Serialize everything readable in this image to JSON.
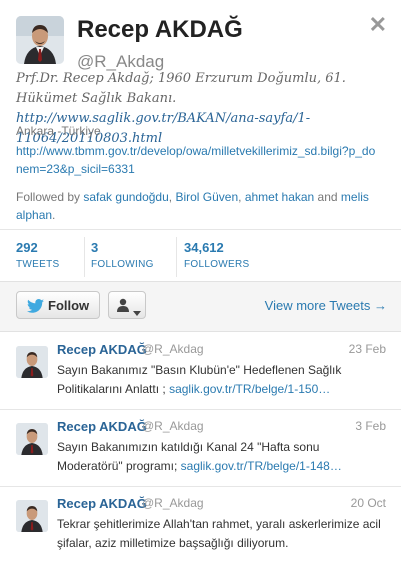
{
  "profile": {
    "name": "Recep AKDAĞ",
    "handle": "@R_Akdag",
    "bio_text": "Prf.Dr. Recep Akdağ; 1960 Erzurum Doğumlu, 61. Hükümet Sağlık Bakanı. ",
    "bio_link": "http://www.saglik.gov.tr/BAKAN/ana-sayfa/1-11064/20110803.html",
    "location": "Ankara -Türkiye",
    "website": "http://www.tbmm.gov.tr/develop/owa/milletvekillerimiz_sd.bilgi?p_donem=23&p_sicil=6331",
    "followed_prefix": "Followed by ",
    "followed_by": [
      "safak gundoğdu",
      "Birol Güven",
      "ahmet hakan",
      "melis alphan"
    ],
    "followed_sep1": ", ",
    "followed_sep2": ", ",
    "followed_and": " and ",
    "followed_end": "."
  },
  "stats": [
    {
      "value": "292",
      "label": "TWEETS"
    },
    {
      "value": "3",
      "label": "FOLLOWING"
    },
    {
      "value": "34,612",
      "label": "FOLLOWERS"
    }
  ],
  "actions": {
    "follow_label": "Follow",
    "view_more": "View more Tweets →"
  },
  "icons": {
    "close": "close-icon",
    "bird": "twitter-bird-icon",
    "user": "user-icon",
    "caret": "caret-down-icon"
  },
  "colors": {
    "link": "#2a7ab0",
    "divider": "#e6e6e6"
  },
  "tweets": [
    {
      "name": "Recep AKDAĞ",
      "handle": "@R_Akdag",
      "date": "23 Feb",
      "text": "Sayın Bakanımız \"Basın Klubün'e\" Hedeflenen Sağlık Politikalarını Anlattı ; ",
      "link": "saglik.gov.tr/TR/belge/1-150…"
    },
    {
      "name": "Recep AKDAĞ",
      "handle": "@R_Akdag",
      "date": "3 Feb",
      "text": "Sayın Bakanımızın katıldığı Kanal 24 \"Hafta sonu Moderatörü\" programı; ",
      "link": "saglik.gov.tr/TR/belge/1-148…"
    },
    {
      "name": "Recep AKDAĞ",
      "handle": "@R_Akdag",
      "date": "20 Oct",
      "text": "Tekrar şehitlerimize Allah'tan rahmet, yaralı askerlerimize acil şifalar, aziz milletimize başsağlığı diliyorum.",
      "link": ""
    }
  ]
}
